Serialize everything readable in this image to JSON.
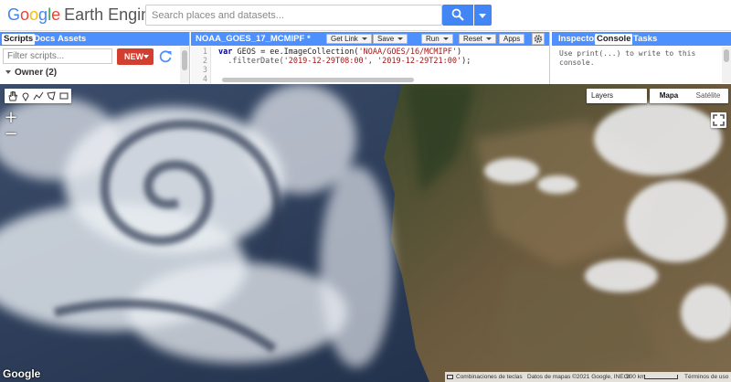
{
  "header": {
    "logo_google": [
      "G",
      "o",
      "o",
      "g",
      "l",
      "e"
    ],
    "logo_product": "Earth Engine",
    "search_placeholder": "Search places and datasets..."
  },
  "left_panel": {
    "tabs": [
      {
        "label": "Scripts",
        "active": true
      },
      {
        "label": "Docs",
        "active": false
      },
      {
        "label": "Assets",
        "active": false
      }
    ],
    "filter_placeholder": "Filter scripts...",
    "new_label": "NEW",
    "owner_label": "Owner (2)"
  },
  "editor": {
    "script_name": "NOAA_GOES_17_MCMIPF *",
    "buttons": {
      "get_link": "Get Link",
      "save": "Save",
      "run": "Run",
      "reset": "Reset",
      "apps": "Apps"
    },
    "lines": [
      {
        "number": "1",
        "kw": "var",
        "ident": " GEOS = ee.ImageCollection(",
        "str": "'NOAA/GOES/16/MCMIPF'",
        "tail": ")"
      },
      {
        "number": "2",
        "kw": "",
        "ident": "  .filterDate(",
        "str": "'2019-12-29T08:00', '2019-12-29T21:00'",
        "tail": ");"
      },
      {
        "number": "3",
        "kw": "",
        "ident": "",
        "str": "",
        "tail": ""
      },
      {
        "number": "4",
        "kw": "",
        "ident": "",
        "str": "",
        "tail": ""
      }
    ]
  },
  "right_panel": {
    "tabs": [
      {
        "label": "Inspector",
        "active": false
      },
      {
        "label": "Console",
        "active": true
      },
      {
        "label": "Tasks",
        "active": false
      }
    ],
    "console_text": "Use print(...) to write to this console."
  },
  "map": {
    "layers_label": "Layers",
    "map_types": [
      {
        "label": "Mapa",
        "active": true
      },
      {
        "label": "Satélite",
        "active": false
      }
    ],
    "zoom_in": "+",
    "zoom_out": "−",
    "google_logo": "Google",
    "footer": {
      "shortcuts": "Combinaciones de teclas",
      "map_data": "Datos de mapas ©2021 Google, INEGI",
      "scale": "200 km",
      "terms": "Términos de uso"
    }
  },
  "colors": {
    "accent_blue": "#4d90fe",
    "search_blue": "#4285f4",
    "new_red": "#d23f31"
  }
}
